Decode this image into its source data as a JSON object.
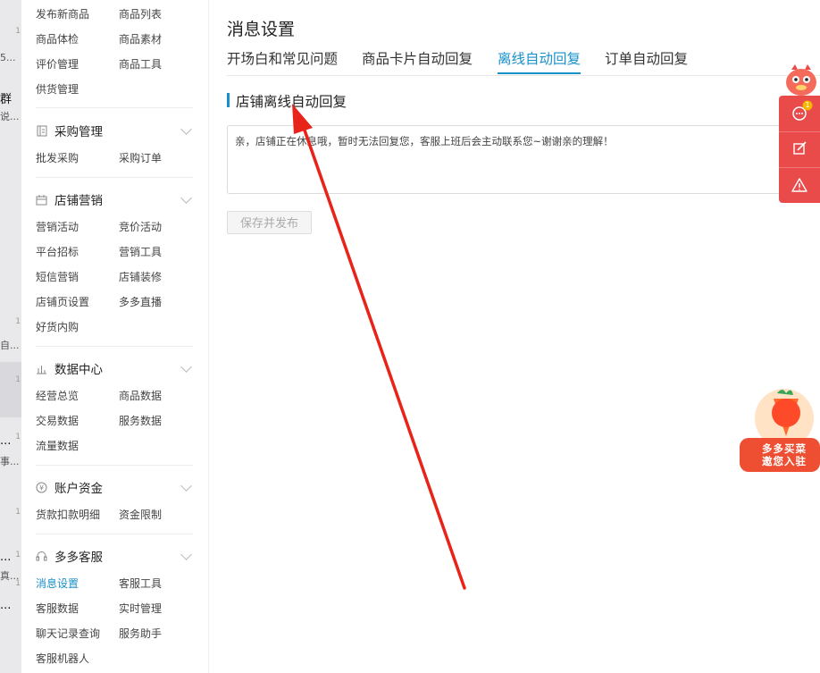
{
  "left_edge": {
    "fragments": [
      "5...",
      "群",
      "说...",
      "1",
      "1",
      "自...",
      "1",
      "...",
      "事...",
      "1",
      "1",
      "...",
      "真...",
      "1",
      "...",
      "1"
    ]
  },
  "sidebar": {
    "top_items": [
      [
        "发布新商品",
        "商品列表"
      ],
      [
        "商品体检",
        "商品素材"
      ],
      [
        "评价管理",
        "商品工具"
      ],
      [
        "供货管理",
        ""
      ]
    ],
    "sections": [
      {
        "title": "采购管理",
        "icon": "document-icon",
        "items": [
          [
            "批发采购",
            "采购订单"
          ]
        ]
      },
      {
        "title": "店铺营销",
        "icon": "calendar-icon",
        "items": [
          [
            "营销活动",
            "竞价活动"
          ],
          [
            "平台招标",
            "营销工具"
          ],
          [
            "短信营销",
            "店铺装修"
          ],
          [
            "店铺页设置",
            "多多直播"
          ],
          [
            "好货内购",
            ""
          ]
        ]
      },
      {
        "title": "数据中心",
        "icon": "bar-chart-icon",
        "items": [
          [
            "经营总览",
            "商品数据"
          ],
          [
            "交易数据",
            "服务数据"
          ],
          [
            "流量数据",
            ""
          ]
        ]
      },
      {
        "title": "账户资金",
        "icon": "yen-icon",
        "items": [
          [
            "货款扣款明细",
            "资金限制"
          ]
        ]
      },
      {
        "title": "多多客服",
        "icon": "headset-icon",
        "items": [
          [
            "消息设置",
            "客服工具"
          ],
          [
            "客服数据",
            "实时管理"
          ],
          [
            "聊天记录查询",
            "服务助手"
          ],
          [
            "客服机器人",
            ""
          ]
        ]
      }
    ],
    "active_item": "消息设置"
  },
  "main": {
    "title": "消息设置",
    "tabs": [
      "开场白和常见问题",
      "商品卡片自动回复",
      "离线自动回复",
      "订单自动回复"
    ],
    "active_tab": "离线自动回复",
    "section_title": "店铺离线自动回复",
    "reply_text": "亲，店铺正在休息哦，暂时无法回复您，客服上班后会主动联系您~谢谢亲的理解！",
    "save_button": "保存并发布"
  },
  "float_bar": {
    "badge": "1",
    "buttons": [
      "chat-icon",
      "edit-icon",
      "warning-icon"
    ],
    "color": "#e94b4b"
  },
  "promo": {
    "line1": "多多买菜",
    "line2": "邀您入驻"
  },
  "colors": {
    "accent": "#1890c9",
    "annotation_arrow": "#e8231a"
  }
}
